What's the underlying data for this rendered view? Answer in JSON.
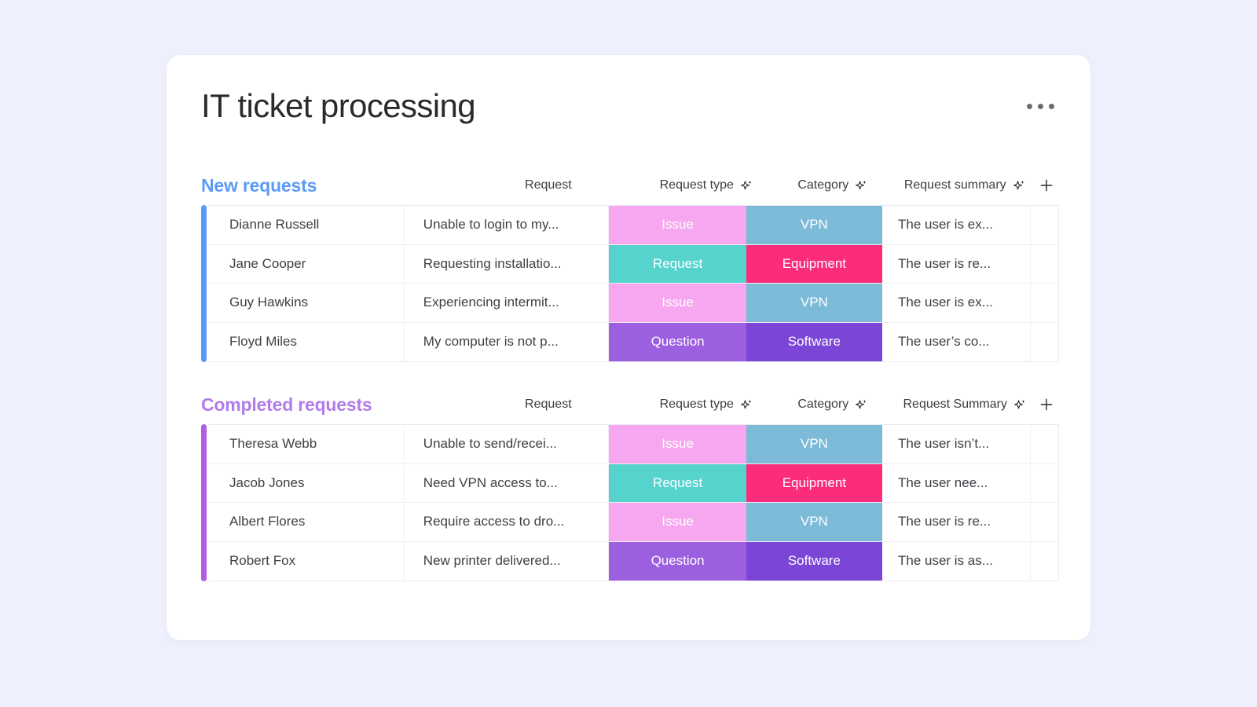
{
  "header": {
    "title": "IT ticket processing",
    "more_menu_label": "More options"
  },
  "icons": {
    "sparkle": "sparkle-ai-icon",
    "plus": "plus-icon",
    "more": "more-horizontal-icon"
  },
  "colors": {
    "page_background": "#eef0fe",
    "card_background": "#ffffff",
    "section_new_accent": "#5b9bf5",
    "section_completed_accent": "#b17ce9",
    "chip_issue": "#f6a7ef",
    "chip_request": "#57d3ce",
    "chip_question": "#9b5fe0",
    "chip_vpn": "#7cbad8",
    "chip_equipment": "#fa2c7b",
    "chip_software": "#7b45d6"
  },
  "sections": [
    {
      "title": "New requests",
      "columns": {
        "name": "",
        "request": "Request",
        "type": "Request type",
        "category": "Category",
        "summary": "Request summary",
        "add": "+"
      },
      "rows": [
        {
          "name": "Dianne Russell",
          "request": "Unable to login to my...",
          "type": "Issue",
          "type_color": "issue",
          "category": "VPN",
          "category_color": "vpn",
          "summary": "The user is ex..."
        },
        {
          "name": "Jane Cooper",
          "request": "Requesting installatio...",
          "type": "Request",
          "type_color": "request",
          "category": "Equipment",
          "category_color": "equipment",
          "summary": "The user is re..."
        },
        {
          "name": "Guy Hawkins",
          "request": "Experiencing intermit...",
          "type": "Issue",
          "type_color": "issue",
          "category": "VPN",
          "category_color": "vpn",
          "summary": "The user is ex..."
        },
        {
          "name": "Floyd Miles",
          "request": "My computer is not p...",
          "type": "Question",
          "type_color": "question",
          "category": "Software",
          "category_color": "software",
          "summary": "The user’s co..."
        }
      ]
    },
    {
      "title": "Completed requests",
      "columns": {
        "name": "",
        "request": "Request",
        "type": "Request type",
        "category": "Category",
        "summary": "Request Summary",
        "add": "+"
      },
      "rows": [
        {
          "name": "Theresa Webb",
          "request": "Unable to send/recei...",
          "type": "Issue",
          "type_color": "issue",
          "category": "VPN",
          "category_color": "vpn",
          "summary": "The user isn’t..."
        },
        {
          "name": "Jacob Jones",
          "request": "Need VPN access to...",
          "type": "Request",
          "type_color": "request",
          "category": "Equipment",
          "category_color": "equipment",
          "summary": "The user nee..."
        },
        {
          "name": "Albert Flores",
          "request": "Require access to dro...",
          "type": "Issue",
          "type_color": "issue",
          "category": "VPN",
          "category_color": "vpn",
          "summary": "The user is re..."
        },
        {
          "name": "Robert Fox",
          "request": "New printer delivered...",
          "type": "Question",
          "type_color": "question",
          "category": "Software",
          "category_color": "software",
          "summary": "The user is as..."
        }
      ]
    }
  ]
}
